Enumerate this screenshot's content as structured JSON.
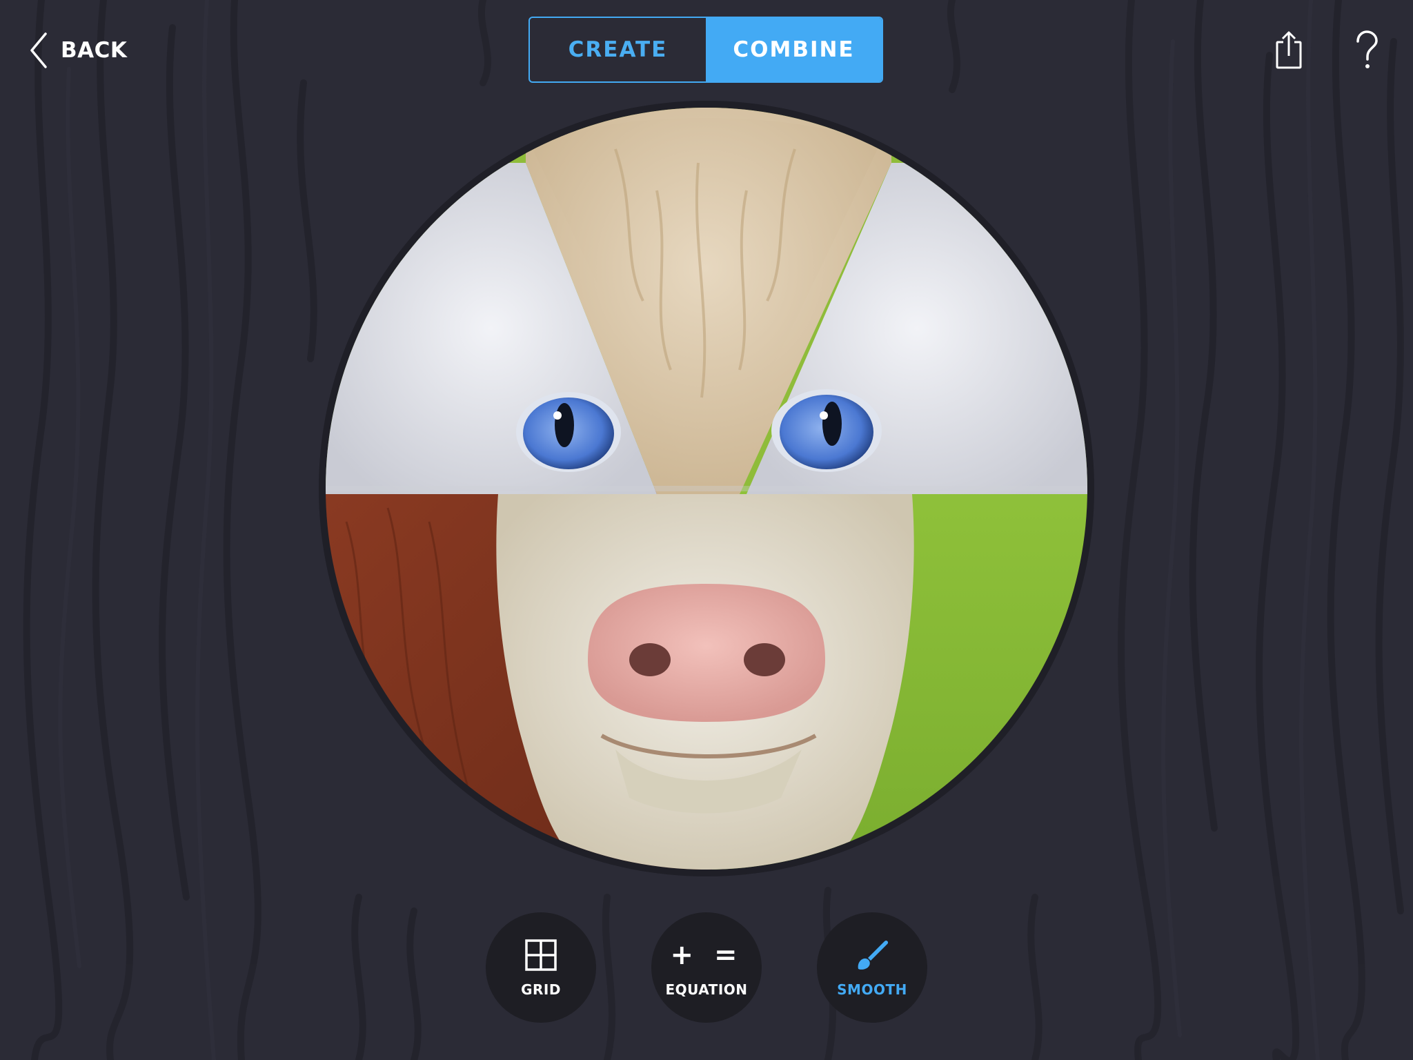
{
  "top_bar": {
    "back_label": "BACK",
    "tabs": [
      {
        "label": "CREATE",
        "selected": false
      },
      {
        "label": "COMBINE",
        "selected": true
      }
    ],
    "share_icon": "share-icon",
    "help_icon": "help-icon"
  },
  "canvas": {
    "description_icon": "combined-animal-face"
  },
  "tools": [
    {
      "label": "GRID",
      "icon": "grid-icon",
      "active": false
    },
    {
      "label": "EQUATION",
      "icon": "plus-equals-icon",
      "glyph": "+ =",
      "active": false
    },
    {
      "label": "SMOOTH",
      "icon": "paintbrush-icon",
      "active": true
    }
  ],
  "colors": {
    "background": "#2b2b36",
    "accent": "#43aaf4",
    "tool_bg": "#1e1e24"
  }
}
